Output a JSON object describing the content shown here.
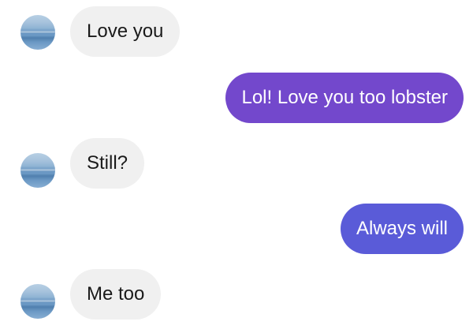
{
  "conversation": {
    "messages": [
      {
        "direction": "incoming",
        "text": "Love you"
      },
      {
        "direction": "outgoing",
        "text": "Lol! Love you too lobster",
        "color": "#7348cc"
      },
      {
        "direction": "incoming",
        "text": "Still?"
      },
      {
        "direction": "outgoing",
        "text": "Always will",
        "color": "#5a5bd8"
      },
      {
        "direction": "incoming",
        "text": "Me too"
      }
    ]
  },
  "colors": {
    "incoming_bubble": "#f0f0f0",
    "outgoing_bubble_top": "#7348cc",
    "outgoing_bubble_bottom": "#5a5bd8"
  }
}
